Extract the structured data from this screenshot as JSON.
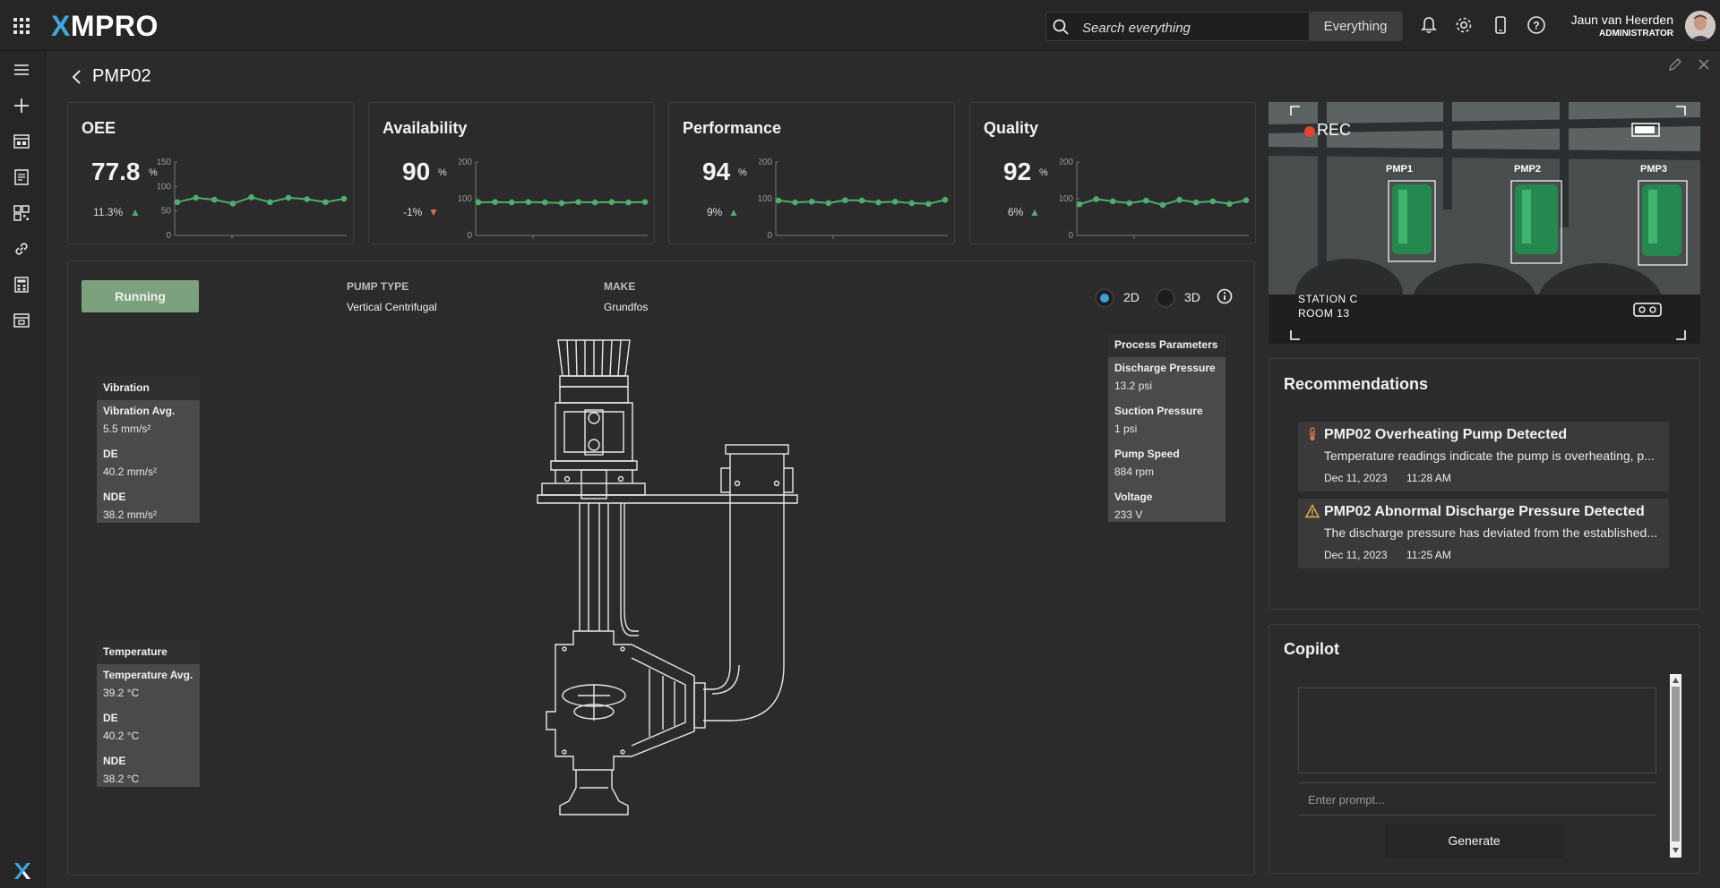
{
  "topbar": {
    "logo_x": "X",
    "logo_rest": "MPRO",
    "search_placeholder": "Search everything",
    "search_scope": "Everything",
    "user_name": "Jaun van Heerden",
    "user_role": "ADMINISTRATOR"
  },
  "page": {
    "title": "PMP02"
  },
  "kpis": [
    {
      "title": "OEE",
      "value": "77.8",
      "unit": "%",
      "delta": "11.3%",
      "trend": "up",
      "ticks": [
        "150",
        "100",
        "50",
        "0"
      ],
      "ymax": 150,
      "series": [
        68,
        77,
        73,
        65,
        78,
        68,
        77,
        74,
        68,
        75
      ]
    },
    {
      "title": "Availability",
      "value": "90",
      "unit": "%",
      "delta": "-1%",
      "trend": "down",
      "ticks": [
        "200",
        "100",
        "0"
      ],
      "ymax": 200,
      "series": [
        90,
        91,
        90,
        91,
        90,
        88,
        91,
        90,
        91,
        90,
        91
      ]
    },
    {
      "title": "Performance",
      "value": "94",
      "unit": "%",
      "delta": "9%",
      "trend": "up",
      "ticks": [
        "200",
        "100",
        "0"
      ],
      "ymax": 200,
      "series": [
        95,
        90,
        92,
        88,
        96,
        95,
        90,
        92,
        88,
        86,
        97
      ]
    },
    {
      "title": "Quality",
      "value": "92",
      "unit": "%",
      "delta": "6%",
      "trend": "up",
      "ticks": [
        "200",
        "100",
        "0"
      ],
      "ymax": 200,
      "series": [
        85,
        99,
        93,
        88,
        95,
        83,
        97,
        90,
        93,
        86,
        96
      ]
    }
  ],
  "asset": {
    "status": "Running",
    "pump_type_label": "PUMP TYPE",
    "pump_type": "Vertical Centrifugal",
    "make_label": "MAKE",
    "make": "Grundfos",
    "view_2d": "2D",
    "view_3d": "3D",
    "view_selected": "2D"
  },
  "vibration": {
    "title": "Vibration",
    "rows": [
      {
        "name": "Vibration Avg.",
        "value": "5.5 mm/s²"
      },
      {
        "name": "DE",
        "value": "40.2 mm/s²"
      },
      {
        "name": "NDE",
        "value": "38.2 mm/s²"
      }
    ]
  },
  "temperature": {
    "title": "Temperature",
    "rows": [
      {
        "name": "Temperature Avg.",
        "value": "39.2 °C"
      },
      {
        "name": "DE",
        "value": "40.2 °C"
      },
      {
        "name": "NDE",
        "value": "38.2 °C"
      }
    ]
  },
  "process": {
    "title": "Process Parameters",
    "rows": [
      {
        "name": "Discharge Pressure",
        "value": "13.2 psi"
      },
      {
        "name": "Suction Pressure",
        "value": "1 psi"
      },
      {
        "name": "Pump Speed",
        "value": "884 rpm"
      },
      {
        "name": "Voltage",
        "value": "233 V"
      }
    ]
  },
  "camera": {
    "rec": "REC",
    "labels": [
      "PMP1",
      "PMP2",
      "PMP3"
    ],
    "location_line1": "STATION C",
    "location_line2": "ROOM 13"
  },
  "recommendations": {
    "title": "Recommendations",
    "items": [
      {
        "icon": "thermometer-icon",
        "title": "PMP02 Overheating Pump Detected",
        "desc": "Temperature readings indicate the pump is overheating, p...",
        "date": "Dec 11, 2023",
        "time": "11:28 AM"
      },
      {
        "icon": "warning-icon",
        "title": "PMP02 Abnormal Discharge Pressure Detected",
        "desc": "The discharge pressure has deviated from the established...",
        "date": "Dec 11, 2023",
        "time": "11:25 AM"
      }
    ]
  },
  "copilot": {
    "title": "Copilot",
    "prompt_placeholder": "Enter prompt...",
    "generate_label": "Generate"
  },
  "colors": {
    "accent": "#3ea7de",
    "spark": "#4caf6a",
    "up": "#4caf6a",
    "down": "#d9704f",
    "running": "#7da07d"
  }
}
